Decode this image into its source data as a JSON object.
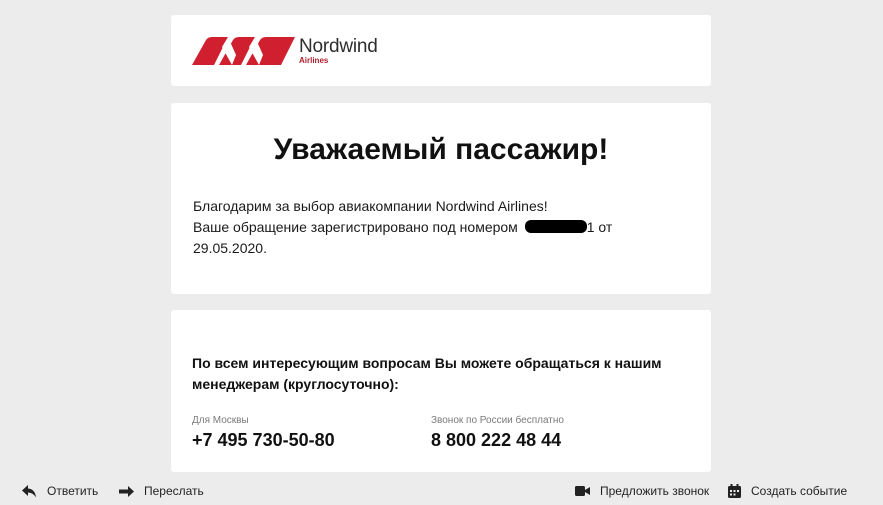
{
  "brand": {
    "name": "Nordwind",
    "sub": "Airlines",
    "colors": {
      "red": "#d01f2f",
      "dark": "#2d2d2d"
    }
  },
  "greeting": {
    "title": "Уважаемый пассажир!",
    "line1": "Благодарим за выбор авиакомпании Nordwind Airlines!",
    "line2_prefix": "Ваше обращение зарегистрировано под номером ",
    "line2_suffix": "1 от",
    "date": "29.05.2020."
  },
  "contacts": {
    "heading": "По всем интересующим вопросам Вы можете обращаться к нашим менеджерам (круглосуточно):",
    "items": [
      {
        "label": "Для Москвы",
        "phone": "+7 495 730-50-80"
      },
      {
        "label": "Звонок по России бесплатно",
        "phone": "8 800 222 48 44"
      }
    ]
  },
  "toolbar": {
    "reply": "Ответить",
    "forward": "Переслать",
    "suggest_call": "Предложить звонок",
    "create_event": "Создать событие",
    "icons": [
      "reply-icon",
      "forward-icon",
      "video-camera-icon",
      "calendar-icon"
    ]
  }
}
